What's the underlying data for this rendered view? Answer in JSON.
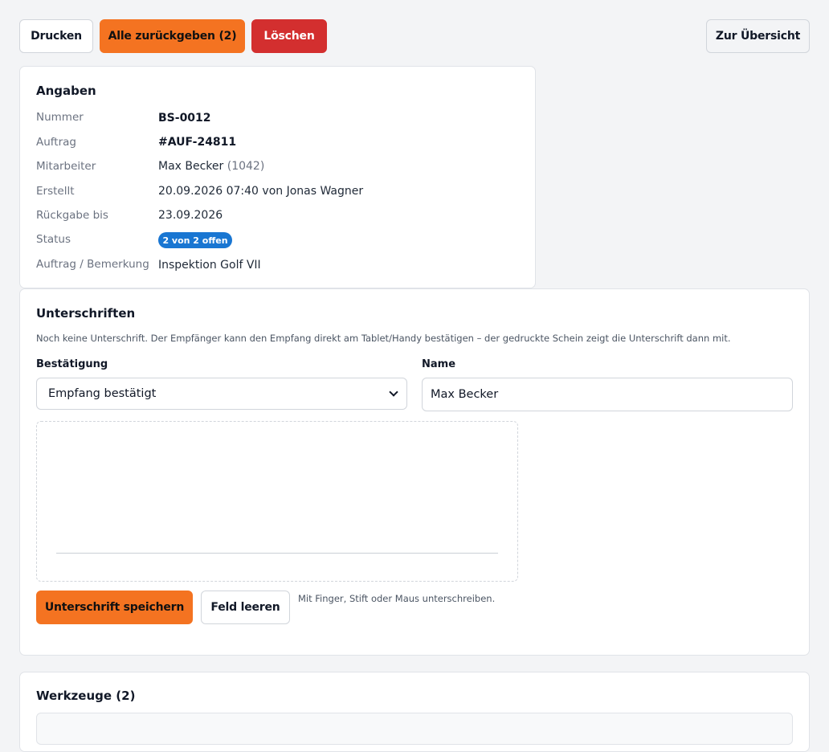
{
  "toolbar": {
    "print_label": "Drucken",
    "return_all_label": "Alle zurückgeben (2)",
    "delete_label": "Löschen",
    "overview_label": "Zur Übersicht"
  },
  "details": {
    "title": "Angaben",
    "rows": [
      {
        "label": "Nummer",
        "value": "BS-0012"
      },
      {
        "label": "Auftrag",
        "value": "#AUF-24811"
      },
      {
        "label": "Mitarbeiter",
        "value": "Max Becker",
        "extra": "(1042)"
      },
      {
        "label": "Erstellt",
        "value": "20.09.2026 07:40 von Jonas Wagner"
      },
      {
        "label": "Rückgabe bis",
        "value": "23.09.2026"
      },
      {
        "label": "Status",
        "value": "2 von 2 offen"
      },
      {
        "label": "Auftrag / Bemerkung",
        "value": "Inspektion Golf VII"
      }
    ],
    "status_color": "#1976d2"
  },
  "signatures": {
    "title": "Unterschriften",
    "hint": "Noch keine Unterschrift. Der Empfänger kann den Empfang direkt am Tablet/Handy bestätigen – der gedruckte Schein zeigt die Unterschrift dann mit.",
    "confirmation_label": "Bestätigung",
    "confirmation_value": "Empfang bestätigt",
    "name_label": "Name",
    "name_value": "Max Becker",
    "save_label": "Unterschrift speichern",
    "clear_label": "Feld leeren",
    "pad_hint": "Mit Finger, Stift oder Maus unterschreiben."
  },
  "tools": {
    "title": "Werkzeuge (2)"
  },
  "colors": {
    "accent": "#f47321",
    "danger": "#d32f2f",
    "background": "#f3f4f6"
  }
}
